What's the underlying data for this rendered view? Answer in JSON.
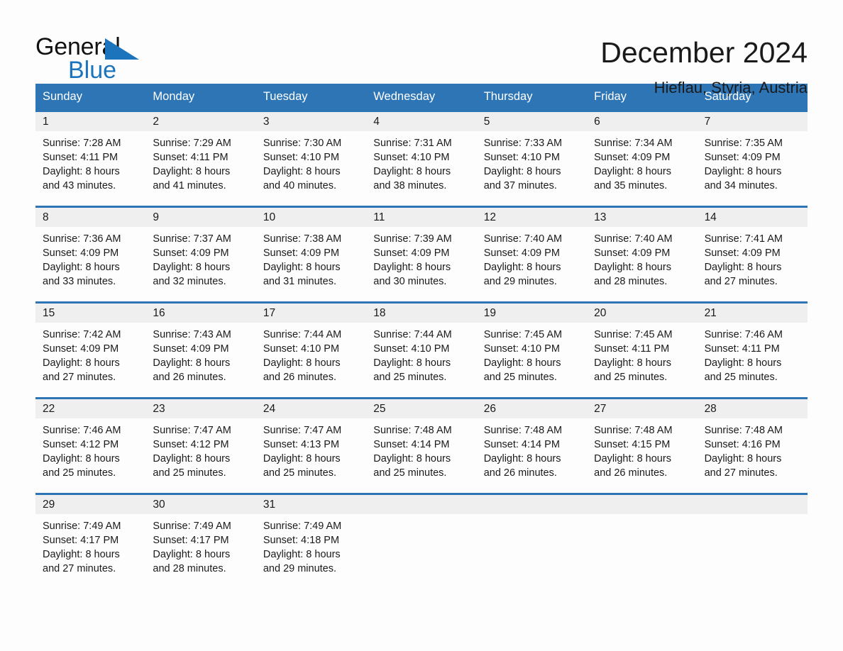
{
  "brand": {
    "name_top": "General",
    "name_bottom": "Blue",
    "accent_color": "#1c74bc"
  },
  "header": {
    "title": "December 2024",
    "subtitle": "Hieflau, Styria, Austria"
  },
  "theme": {
    "header_blue": "#2e75b6",
    "day_band_gray": "#efefef",
    "page_background": "#fdfdfd",
    "text_color": "#1a1a1a"
  },
  "weekdays": [
    "Sunday",
    "Monday",
    "Tuesday",
    "Wednesday",
    "Thursday",
    "Friday",
    "Saturday"
  ],
  "weeks": [
    [
      {
        "day": "1",
        "sunrise": "Sunrise: 7:28 AM",
        "sunset": "Sunset: 4:11 PM",
        "daylight_line1": "Daylight: 8 hours",
        "daylight_line2": "and 43 minutes."
      },
      {
        "day": "2",
        "sunrise": "Sunrise: 7:29 AM",
        "sunset": "Sunset: 4:11 PM",
        "daylight_line1": "Daylight: 8 hours",
        "daylight_line2": "and 41 minutes."
      },
      {
        "day": "3",
        "sunrise": "Sunrise: 7:30 AM",
        "sunset": "Sunset: 4:10 PM",
        "daylight_line1": "Daylight: 8 hours",
        "daylight_line2": "and 40 minutes."
      },
      {
        "day": "4",
        "sunrise": "Sunrise: 7:31 AM",
        "sunset": "Sunset: 4:10 PM",
        "daylight_line1": "Daylight: 8 hours",
        "daylight_line2": "and 38 minutes."
      },
      {
        "day": "5",
        "sunrise": "Sunrise: 7:33 AM",
        "sunset": "Sunset: 4:10 PM",
        "daylight_line1": "Daylight: 8 hours",
        "daylight_line2": "and 37 minutes."
      },
      {
        "day": "6",
        "sunrise": "Sunrise: 7:34 AM",
        "sunset": "Sunset: 4:09 PM",
        "daylight_line1": "Daylight: 8 hours",
        "daylight_line2": "and 35 minutes."
      },
      {
        "day": "7",
        "sunrise": "Sunrise: 7:35 AM",
        "sunset": "Sunset: 4:09 PM",
        "daylight_line1": "Daylight: 8 hours",
        "daylight_line2": "and 34 minutes."
      }
    ],
    [
      {
        "day": "8",
        "sunrise": "Sunrise: 7:36 AM",
        "sunset": "Sunset: 4:09 PM",
        "daylight_line1": "Daylight: 8 hours",
        "daylight_line2": "and 33 minutes."
      },
      {
        "day": "9",
        "sunrise": "Sunrise: 7:37 AM",
        "sunset": "Sunset: 4:09 PM",
        "daylight_line1": "Daylight: 8 hours",
        "daylight_line2": "and 32 minutes."
      },
      {
        "day": "10",
        "sunrise": "Sunrise: 7:38 AM",
        "sunset": "Sunset: 4:09 PM",
        "daylight_line1": "Daylight: 8 hours",
        "daylight_line2": "and 31 minutes."
      },
      {
        "day": "11",
        "sunrise": "Sunrise: 7:39 AM",
        "sunset": "Sunset: 4:09 PM",
        "daylight_line1": "Daylight: 8 hours",
        "daylight_line2": "and 30 minutes."
      },
      {
        "day": "12",
        "sunrise": "Sunrise: 7:40 AM",
        "sunset": "Sunset: 4:09 PM",
        "daylight_line1": "Daylight: 8 hours",
        "daylight_line2": "and 29 minutes."
      },
      {
        "day": "13",
        "sunrise": "Sunrise: 7:40 AM",
        "sunset": "Sunset: 4:09 PM",
        "daylight_line1": "Daylight: 8 hours",
        "daylight_line2": "and 28 minutes."
      },
      {
        "day": "14",
        "sunrise": "Sunrise: 7:41 AM",
        "sunset": "Sunset: 4:09 PM",
        "daylight_line1": "Daylight: 8 hours",
        "daylight_line2": "and 27 minutes."
      }
    ],
    [
      {
        "day": "15",
        "sunrise": "Sunrise: 7:42 AM",
        "sunset": "Sunset: 4:09 PM",
        "daylight_line1": "Daylight: 8 hours",
        "daylight_line2": "and 27 minutes."
      },
      {
        "day": "16",
        "sunrise": "Sunrise: 7:43 AM",
        "sunset": "Sunset: 4:09 PM",
        "daylight_line1": "Daylight: 8 hours",
        "daylight_line2": "and 26 minutes."
      },
      {
        "day": "17",
        "sunrise": "Sunrise: 7:44 AM",
        "sunset": "Sunset: 4:10 PM",
        "daylight_line1": "Daylight: 8 hours",
        "daylight_line2": "and 26 minutes."
      },
      {
        "day": "18",
        "sunrise": "Sunrise: 7:44 AM",
        "sunset": "Sunset: 4:10 PM",
        "daylight_line1": "Daylight: 8 hours",
        "daylight_line2": "and 25 minutes."
      },
      {
        "day": "19",
        "sunrise": "Sunrise: 7:45 AM",
        "sunset": "Sunset: 4:10 PM",
        "daylight_line1": "Daylight: 8 hours",
        "daylight_line2": "and 25 minutes."
      },
      {
        "day": "20",
        "sunrise": "Sunrise: 7:45 AM",
        "sunset": "Sunset: 4:11 PM",
        "daylight_line1": "Daylight: 8 hours",
        "daylight_line2": "and 25 minutes."
      },
      {
        "day": "21",
        "sunrise": "Sunrise: 7:46 AM",
        "sunset": "Sunset: 4:11 PM",
        "daylight_line1": "Daylight: 8 hours",
        "daylight_line2": "and 25 minutes."
      }
    ],
    [
      {
        "day": "22",
        "sunrise": "Sunrise: 7:46 AM",
        "sunset": "Sunset: 4:12 PM",
        "daylight_line1": "Daylight: 8 hours",
        "daylight_line2": "and 25 minutes."
      },
      {
        "day": "23",
        "sunrise": "Sunrise: 7:47 AM",
        "sunset": "Sunset: 4:12 PM",
        "daylight_line1": "Daylight: 8 hours",
        "daylight_line2": "and 25 minutes."
      },
      {
        "day": "24",
        "sunrise": "Sunrise: 7:47 AM",
        "sunset": "Sunset: 4:13 PM",
        "daylight_line1": "Daylight: 8 hours",
        "daylight_line2": "and 25 minutes."
      },
      {
        "day": "25",
        "sunrise": "Sunrise: 7:48 AM",
        "sunset": "Sunset: 4:14 PM",
        "daylight_line1": "Daylight: 8 hours",
        "daylight_line2": "and 25 minutes."
      },
      {
        "day": "26",
        "sunrise": "Sunrise: 7:48 AM",
        "sunset": "Sunset: 4:14 PM",
        "daylight_line1": "Daylight: 8 hours",
        "daylight_line2": "and 26 minutes."
      },
      {
        "day": "27",
        "sunrise": "Sunrise: 7:48 AM",
        "sunset": "Sunset: 4:15 PM",
        "daylight_line1": "Daylight: 8 hours",
        "daylight_line2": "and 26 minutes."
      },
      {
        "day": "28",
        "sunrise": "Sunrise: 7:48 AM",
        "sunset": "Sunset: 4:16 PM",
        "daylight_line1": "Daylight: 8 hours",
        "daylight_line2": "and 27 minutes."
      }
    ],
    [
      {
        "day": "29",
        "sunrise": "Sunrise: 7:49 AM",
        "sunset": "Sunset: 4:17 PM",
        "daylight_line1": "Daylight: 8 hours",
        "daylight_line2": "and 27 minutes."
      },
      {
        "day": "30",
        "sunrise": "Sunrise: 7:49 AM",
        "sunset": "Sunset: 4:17 PM",
        "daylight_line1": "Daylight: 8 hours",
        "daylight_line2": "and 28 minutes."
      },
      {
        "day": "31",
        "sunrise": "Sunrise: 7:49 AM",
        "sunset": "Sunset: 4:18 PM",
        "daylight_line1": "Daylight: 8 hours",
        "daylight_line2": "and 29 minutes."
      },
      {
        "day": "",
        "sunrise": "",
        "sunset": "",
        "daylight_line1": "",
        "daylight_line2": ""
      },
      {
        "day": "",
        "sunrise": "",
        "sunset": "",
        "daylight_line1": "",
        "daylight_line2": ""
      },
      {
        "day": "",
        "sunrise": "",
        "sunset": "",
        "daylight_line1": "",
        "daylight_line2": ""
      },
      {
        "day": "",
        "sunrise": "",
        "sunset": "",
        "daylight_line1": "",
        "daylight_line2": ""
      }
    ]
  ]
}
